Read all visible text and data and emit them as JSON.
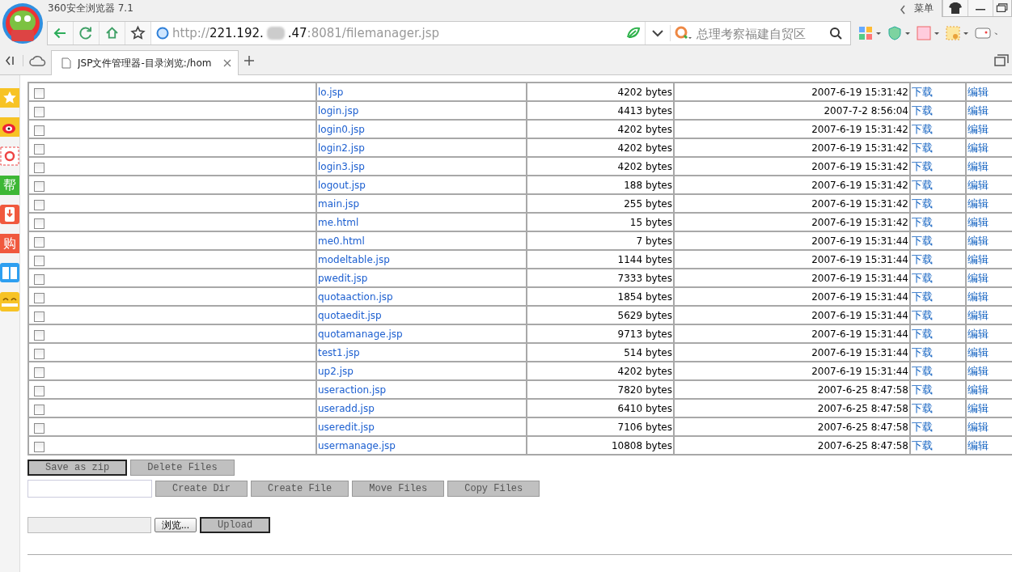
{
  "window": {
    "title": "360安全浏览器 7.1",
    "menu_label": "菜单"
  },
  "address_bar": {
    "scheme": "http://",
    "host_start": "221.192.",
    "host_end": ".47",
    "path": ":8081/filemanager.jsp",
    "search_placeholder": "总理考察福建自贸区"
  },
  "tabs": [
    {
      "label": "JSP文件管理器-目录浏览:/hom",
      "selected": true
    }
  ],
  "sidebar": {
    "items": [
      {
        "kind": "star",
        "color": "#f7c325"
      },
      {
        "kind": "weibo",
        "color": "#f7c325"
      },
      {
        "kind": "mail",
        "color": "#ffffff"
      },
      {
        "kind": "glyph",
        "glyph": "帮",
        "color": "#3db735"
      },
      {
        "kind": "download",
        "color": "#f0593e"
      },
      {
        "kind": "glyph",
        "glyph": "购",
        "color": "#f0593e"
      },
      {
        "kind": "book",
        "color": "#2e9ff0"
      },
      {
        "kind": "face",
        "color": "#f7c325"
      }
    ]
  },
  "table": {
    "rows": [
      {
        "checked": false,
        "name": "lo.jsp",
        "size": "4202 bytes",
        "date": "2007-6-19 15:31:42",
        "download": "下载",
        "edit": "编辑"
      },
      {
        "checked": false,
        "name": "login.jsp",
        "size": "4413 bytes",
        "date": "2007-7-2 8:56:04",
        "download": "下载",
        "edit": "编辑"
      },
      {
        "checked": false,
        "name": "login0.jsp",
        "size": "4202 bytes",
        "date": "2007-6-19 15:31:42",
        "download": "下载",
        "edit": "编辑"
      },
      {
        "checked": false,
        "name": "login2.jsp",
        "size": "4202 bytes",
        "date": "2007-6-19 15:31:42",
        "download": "下载",
        "edit": "编辑"
      },
      {
        "checked": false,
        "name": "login3.jsp",
        "size": "4202 bytes",
        "date": "2007-6-19 15:31:42",
        "download": "下载",
        "edit": "编辑"
      },
      {
        "checked": false,
        "name": "logout.jsp",
        "size": "188 bytes",
        "date": "2007-6-19 15:31:42",
        "download": "下载",
        "edit": "编辑"
      },
      {
        "checked": false,
        "name": "main.jsp",
        "size": "255 bytes",
        "date": "2007-6-19 15:31:42",
        "download": "下载",
        "edit": "编辑"
      },
      {
        "checked": false,
        "name": "me.html",
        "size": "15 bytes",
        "date": "2007-6-19 15:31:42",
        "download": "下载",
        "edit": "编辑"
      },
      {
        "checked": false,
        "name": "me0.html",
        "size": "7 bytes",
        "date": "2007-6-19 15:31:44",
        "download": "下载",
        "edit": "编辑"
      },
      {
        "checked": false,
        "name": "modeltable.jsp",
        "size": "1144 bytes",
        "date": "2007-6-19 15:31:44",
        "download": "下载",
        "edit": "编辑"
      },
      {
        "checked": false,
        "name": "pwedit.jsp",
        "size": "7333 bytes",
        "date": "2007-6-19 15:31:44",
        "download": "下载",
        "edit": "编辑"
      },
      {
        "checked": false,
        "name": "quotaaction.jsp",
        "size": "1854 bytes",
        "date": "2007-6-19 15:31:44",
        "download": "下载",
        "edit": "编辑"
      },
      {
        "checked": false,
        "name": "quotaedit.jsp",
        "size": "5629 bytes",
        "date": "2007-6-19 15:31:44",
        "download": "下载",
        "edit": "编辑"
      },
      {
        "checked": false,
        "name": "quotamanage.jsp",
        "size": "9713 bytes",
        "date": "2007-6-19 15:31:44",
        "download": "下载",
        "edit": "编辑"
      },
      {
        "checked": false,
        "name": "test1.jsp",
        "size": "514 bytes",
        "date": "2007-6-19 15:31:44",
        "download": "下载",
        "edit": "编辑"
      },
      {
        "checked": false,
        "name": "up2.jsp",
        "size": "4202 bytes",
        "date": "2007-6-19 15:31:44",
        "download": "下载",
        "edit": "编辑"
      },
      {
        "checked": false,
        "name": "useraction.jsp",
        "size": "7820 bytes",
        "date": "2007-6-25 8:47:58",
        "download": "下载",
        "edit": "编辑"
      },
      {
        "checked": false,
        "name": "useradd.jsp",
        "size": "6410 bytes",
        "date": "2007-6-25 8:47:58",
        "download": "下载",
        "edit": "编辑"
      },
      {
        "checked": false,
        "name": "useredit.jsp",
        "size": "7106 bytes",
        "date": "2007-6-25 8:47:58",
        "download": "下载",
        "edit": "编辑"
      },
      {
        "checked": false,
        "name": "usermanage.jsp",
        "size": "10808 bytes",
        "date": "2007-6-25 8:47:58",
        "download": "下载",
        "edit": "编辑"
      }
    ]
  },
  "actions": {
    "row1": [
      "Save as zip",
      "Delete Files"
    ],
    "row2": [
      "Create Dir",
      "Create File",
      "Move Files",
      "Copy Files"
    ],
    "browse": "浏览...",
    "upload": "Upload"
  }
}
